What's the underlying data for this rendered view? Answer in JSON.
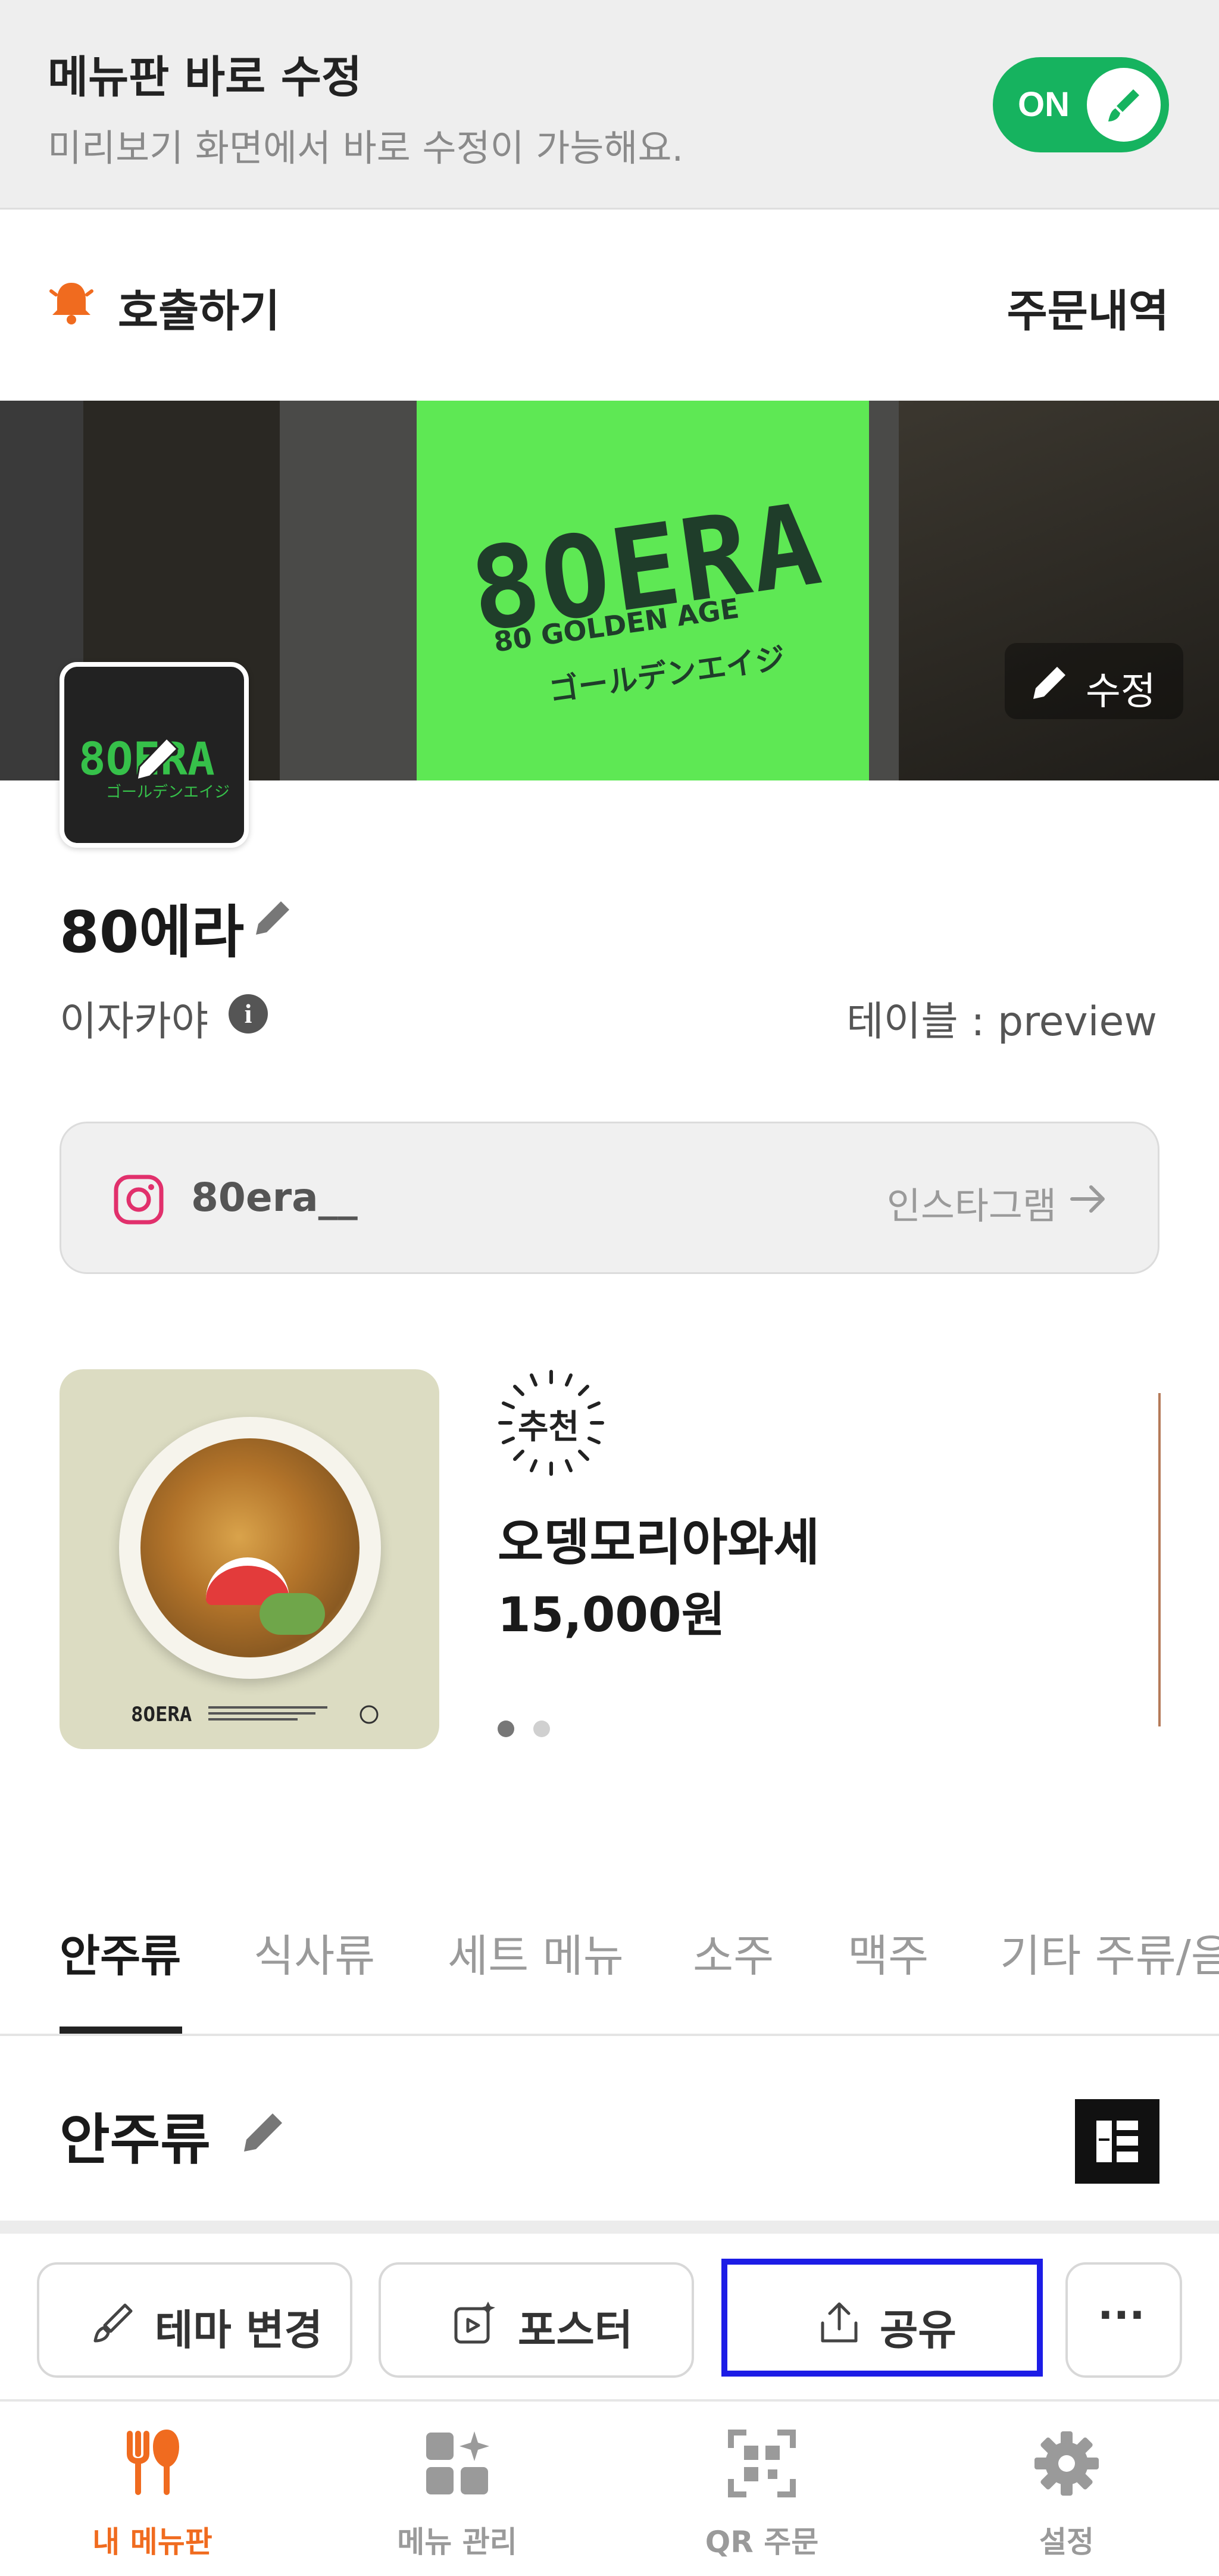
{
  "edit_bar": {
    "title": "메뉴판 바로 수정",
    "subtitle": "미리보기 화면에서 바로 수정이 가능해요.",
    "toggle_label": "ON"
  },
  "header": {
    "call_label": "호출하기",
    "order_history": "주문내역"
  },
  "cover": {
    "edit_label": "수정",
    "sign_logo": "8OERA",
    "sign_sub": "80 GOLDEN AGE",
    "sign_jp": "ゴールデンエイジ"
  },
  "store": {
    "logo_text": "8OERA",
    "logo_jp": "ゴールデンエイジ",
    "name": "80에라",
    "category": "이자카야",
    "info_icon": "i",
    "table_label": "테이블 : preview"
  },
  "instagram": {
    "handle": "80era__",
    "link_label": "인스타그램"
  },
  "featured": {
    "badge": "추천",
    "name": "오뎅모리아와세",
    "price": "15,000원",
    "image_brand": "8OERA"
  },
  "tabs": [
    {
      "label": "안주류"
    },
    {
      "label": "식사류"
    },
    {
      "label": "세트 메뉴"
    },
    {
      "label": "소주"
    },
    {
      "label": "맥주"
    },
    {
      "label": "기타 주류/음료"
    }
  ],
  "section": {
    "title": "안주류"
  },
  "actions": {
    "theme": "테마 변경",
    "poster": "포스터",
    "share": "공유",
    "more": "···"
  },
  "bottom_nav": [
    {
      "label": "내 메뉴판",
      "icon": "fork-knife-icon"
    },
    {
      "label": "메뉴 관리",
      "icon": "grid-sparkle-icon"
    },
    {
      "label": "QR 주문",
      "icon": "qr-scan-icon"
    },
    {
      "label": "설정",
      "icon": "gear-icon"
    }
  ],
  "colors": {
    "toggle_on": "#16b35f",
    "accent": "#f06b1f",
    "share_highlight": "#1c1ce6",
    "instagram": "#e1306c"
  }
}
